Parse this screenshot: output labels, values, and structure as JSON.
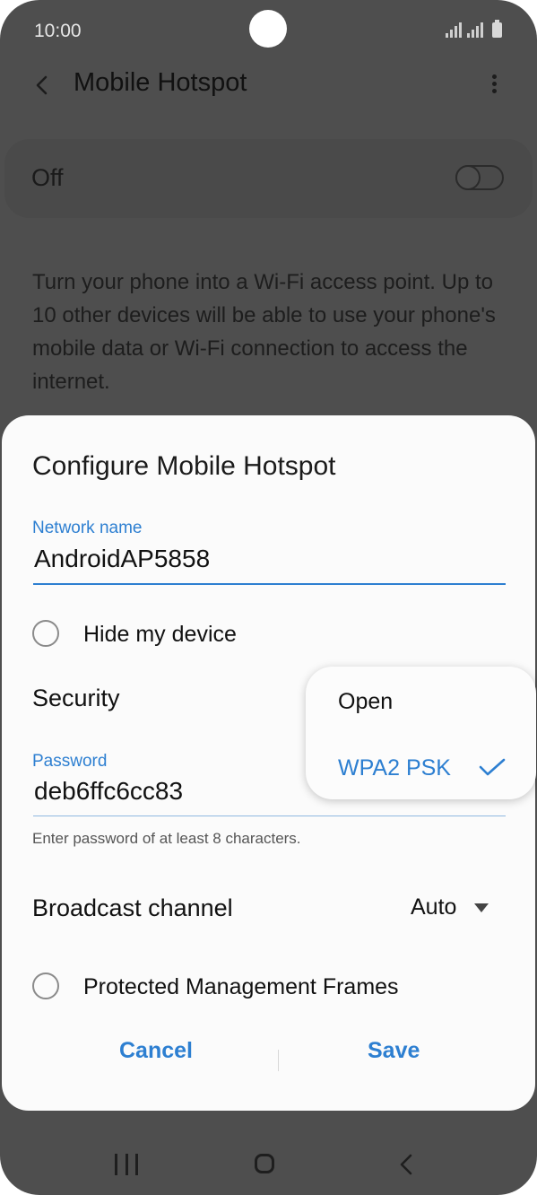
{
  "status_bar": {
    "time": "10:00",
    "icons": [
      "signal-icon",
      "signal-icon",
      "battery-icon"
    ]
  },
  "app_bar": {
    "title": "Mobile Hotspot",
    "back_icon": "back-arrow-icon",
    "menu_icon": "more-vert-icon"
  },
  "hotspot_toggle": {
    "label": "Off",
    "state": false
  },
  "description": "Turn your phone into a Wi-Fi access point. Up to 10 other devices will be able to use your phone's mobile data or Wi-Fi connection to access the internet.",
  "dialog": {
    "title": "Configure Mobile Hotspot",
    "network_name": {
      "label": "Network name",
      "value": "AndroidAP5858"
    },
    "hide_device": {
      "label": "Hide my device",
      "checked": false
    },
    "security": {
      "label": "Security"
    },
    "password": {
      "label": "Password",
      "value": "deb6ffc6cc83",
      "hint": "Enter password of at least 8 characters."
    },
    "broadcast_channel": {
      "label": "Broadcast channel",
      "value": "Auto"
    },
    "pmf": {
      "label": "Protected Management Frames",
      "checked": false
    },
    "cancel_label": "Cancel",
    "save_label": "Save"
  },
  "security_dropdown": {
    "options": [
      "Open",
      "WPA2 PSK"
    ],
    "selected": "WPA2 PSK"
  },
  "nav_bar": {
    "icons": [
      "recents-icon",
      "home-icon",
      "back-icon"
    ]
  },
  "colors": {
    "accent": "#2d7fd1",
    "scrim": "#4e4e4e",
    "dialog": "#fbfbfb"
  }
}
